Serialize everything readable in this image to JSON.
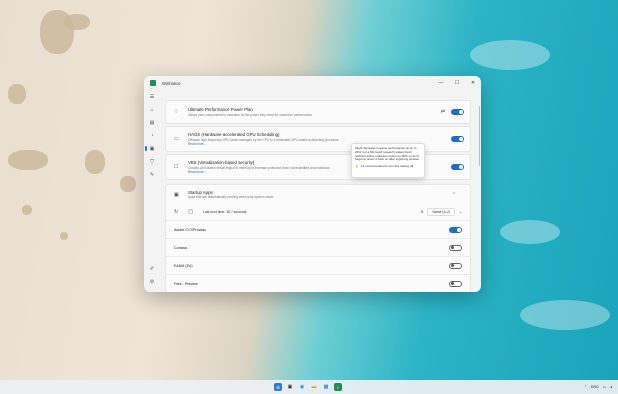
{
  "window": {
    "title": "Winhance",
    "controls": {
      "minimize": "—",
      "maximize": "☐",
      "close": "✕"
    }
  },
  "sidebar": {
    "items": [
      {
        "icon": "menu-icon",
        "glyph": "☰"
      },
      {
        "icon": "home-icon",
        "glyph": "⌂"
      },
      {
        "icon": "software-icon",
        "glyph": "▤"
      },
      {
        "icon": "optimize-icon",
        "glyph": "◔"
      },
      {
        "icon": "customize-icon",
        "glyph": "▣"
      },
      {
        "icon": "about-icon",
        "glyph": "⛉"
      },
      {
        "icon": "edit-icon",
        "glyph": "✎"
      }
    ],
    "bottom": [
      {
        "icon": "brush-icon",
        "glyph": "✐"
      },
      {
        "icon": "settings-icon",
        "glyph": "⚙"
      }
    ]
  },
  "settings": [
    {
      "title": "Ultimate Performance Power Plan",
      "desc": "Allows your components to consume all the power they need for maximum performance",
      "link": "",
      "icon_glyph": "♡",
      "enabled": true
    },
    {
      "title": "HAGS (Hardware-accelerated GPU Scheduling)",
      "desc": "Offloads high-frequency GPU tasks managed by the CPU to a dedicated GPU-based scheduling processor",
      "link": "Read more...",
      "icon_glyph": "▭",
      "enabled": true
    },
    {
      "title": "VBS (Virtualization-based security)",
      "desc": "Creates an isolated virtual region of memory to increase protection from vulnerabilities and malicious",
      "link": "Read more...",
      "icon_glyph": "☐",
      "enabled": true
    }
  ],
  "tooltip": {
    "text": "Might decrease in-game performance by up to 20%, but a Microsoft research states that it reduced active malware reports by 60% so don't forget to revert it back on after a gaming session.",
    "recommendation": "It's recommended to turn this setting off."
  },
  "startup": {
    "title": "Startup Apps",
    "desc": "Apps that are automatically running when your system starts",
    "last_boot": "Last boot time: 18.7 seconds",
    "sort_label": "Name (A-Z)",
    "apps": [
      {
        "name": "Adobe CCXProcess",
        "enabled": true
      },
      {
        "name": "Cortana",
        "enabled": false
      },
      {
        "name": "EADM (EA)",
        "enabled": false
      },
      {
        "name": "Files - Preview",
        "enabled": false
      }
    ]
  },
  "taskbar": {
    "tray_lang": "ENG"
  }
}
